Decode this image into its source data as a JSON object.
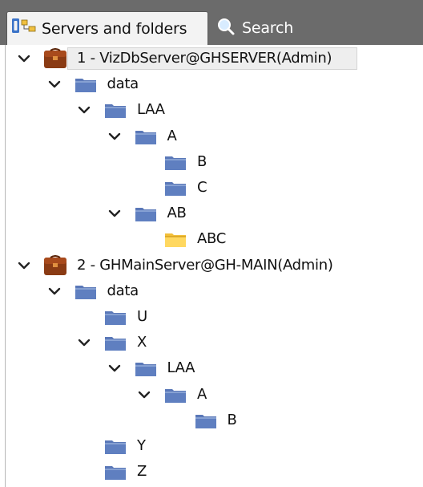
{
  "tabs": [
    {
      "label": "Servers and folders",
      "icon": "tree-view-icon",
      "active": true
    },
    {
      "label": "Search",
      "icon": "search-icon",
      "active": false
    }
  ],
  "tree": [
    {
      "label": "1 - VizDbServer@GHSERVER(Admin)",
      "type": "server",
      "level": 0,
      "expanded": true,
      "selected": true
    },
    {
      "label": "data",
      "type": "folder",
      "level": 1,
      "expanded": true
    },
    {
      "label": "LAA",
      "type": "folder",
      "level": 2,
      "expanded": true
    },
    {
      "label": "A",
      "type": "folder",
      "level": 3,
      "expanded": true
    },
    {
      "label": "B",
      "type": "folder",
      "level": 4
    },
    {
      "label": "C",
      "type": "folder",
      "level": 4
    },
    {
      "label": "AB",
      "type": "folder",
      "level": 3,
      "expanded": true
    },
    {
      "label": "ABC",
      "type": "folder-open",
      "level": 4
    },
    {
      "label": "2 - GHMainServer@GH-MAIN(Admin)",
      "type": "server",
      "level": 0,
      "expanded": true
    },
    {
      "label": "data",
      "type": "folder",
      "level": 1,
      "expanded": true
    },
    {
      "label": "U",
      "type": "folder",
      "level": 2
    },
    {
      "label": "X",
      "type": "folder",
      "level": 2,
      "expanded": true
    },
    {
      "label": "LAA",
      "type": "folder",
      "level": 3,
      "expanded": true
    },
    {
      "label": "A",
      "type": "folder",
      "level": 4,
      "expanded": true
    },
    {
      "label": "B",
      "type": "folder",
      "level": 5
    },
    {
      "label": "Y",
      "type": "folder",
      "level": 2
    },
    {
      "label": "Z",
      "type": "folder",
      "level": 2
    }
  ],
  "colors": {
    "tab_bar": "#6b6b6b",
    "folder_blue": "#5f7fc0",
    "folder_yellow": "#f2bf3a",
    "server_brown": "#8a3b14"
  }
}
